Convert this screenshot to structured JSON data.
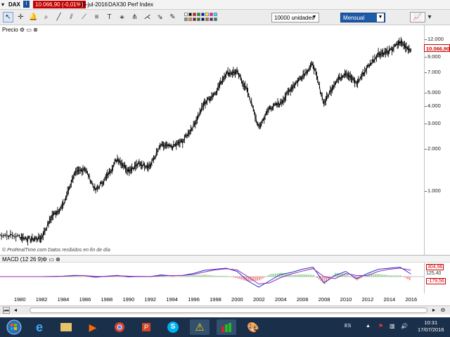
{
  "titlebar": {
    "symbol": "DAX",
    "price": "10.066,90 (-0,01%)",
    "date": "15-jul-2016",
    "name": "DAX30 Perf Index"
  },
  "toolbar": {
    "quantity_select": "10000 unidades",
    "period_select": "Mensual",
    "swatch_colors": [
      "#ffffff",
      "#000000",
      "#ff0000",
      "#00aa00",
      "#0000ff",
      "#ffff00",
      "#ff00ff",
      "#00ffff",
      "#888888",
      "#ff8800",
      "#aa0000",
      "#008800",
      "#000088",
      "#888800",
      "#880088",
      "#008888"
    ]
  },
  "chart": {
    "price_label": "Precio",
    "source_note": "© ProRealTime.com  Datos recibidos en fin de día",
    "price_badge": "10.066,90",
    "macd_label": "MACD (12 26 9)",
    "macd_values": [
      "304,96",
      "125,40",
      "-179,56"
    ],
    "y_ticks": [
      "12.000",
      "9.000",
      "7.000",
      "5.000",
      "4.000",
      "3.000",
      "2.000",
      "1.000"
    ],
    "x_ticks": [
      "1980",
      "1982",
      "1984",
      "1986",
      "1988",
      "1990",
      "1992",
      "1994",
      "1996",
      "1998",
      "2000",
      "2002",
      "2004",
      "2006",
      "2008",
      "2010",
      "2012",
      "2014",
      "2016"
    ]
  },
  "chart_data": {
    "type": "line",
    "x": [
      1978,
      1980,
      1981,
      1982,
      1983,
      1984,
      1985,
      1986,
      1987,
      1988,
      1989,
      1990,
      1991,
      1992,
      1993,
      1994,
      1995,
      1996,
      1997,
      1998,
      1999,
      2000,
      2001,
      2002,
      2003,
      2004,
      2005,
      2006,
      2007,
      2008,
      2009,
      2010,
      2011,
      2012,
      2013,
      2014,
      2015,
      2016
    ],
    "y": [
      490,
      470,
      450,
      460,
      660,
      780,
      1300,
      1450,
      1000,
      1250,
      1700,
      1400,
      1550,
      1500,
      2100,
      2050,
      2250,
      2900,
      4200,
      5000,
      6900,
      7000,
      5100,
      2800,
      3900,
      4200,
      5400,
      6600,
      8000,
      4200,
      5900,
      7000,
      5800,
      7600,
      9500,
      9800,
      11500,
      10066
    ],
    "ylim": [
      400,
      13500
    ],
    "log_scale": true,
    "xlim": [
      1978.2,
      2017.2
    ],
    "grid": false,
    "macd_series": [
      {
        "values": [
          0,
          0,
          0,
          0,
          10,
          20,
          60,
          50,
          -30,
          20,
          60,
          -10,
          10,
          0,
          80,
          40,
          60,
          150,
          300,
          350,
          400,
          250,
          -200,
          -500,
          -200,
          100,
          200,
          350,
          450,
          -300,
          50,
          250,
          -100,
          150,
          350,
          400,
          450,
          125
        ]
      },
      {
        "values": [
          0,
          0,
          0,
          0,
          5,
          15,
          40,
          50,
          10,
          10,
          40,
          20,
          10,
          5,
          40,
          50,
          50,
          100,
          220,
          320,
          370,
          320,
          0,
          -350,
          -300,
          -50,
          130,
          260,
          380,
          0,
          -100,
          150,
          50,
          50,
          250,
          350,
          400,
          305
        ]
      }
    ]
  }
}
